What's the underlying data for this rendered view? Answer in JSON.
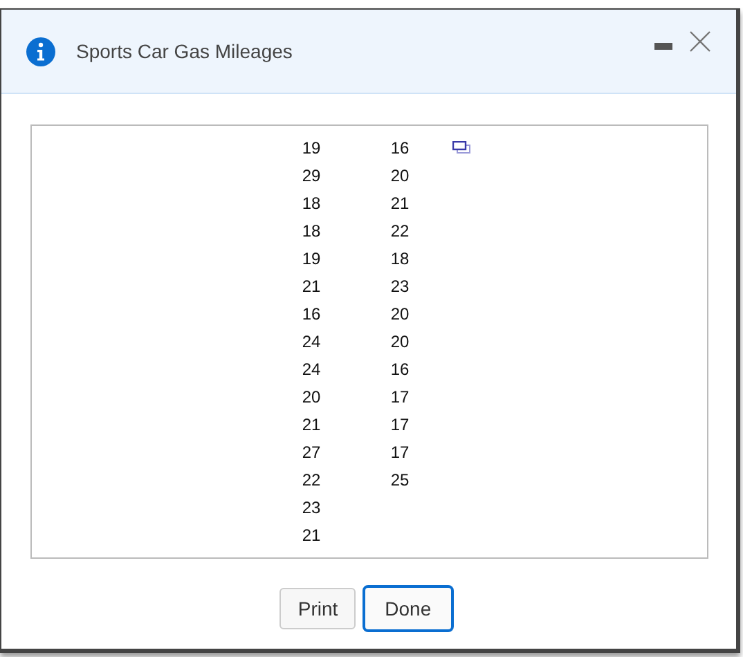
{
  "dialog": {
    "title": "Sports Car Gas Mileages"
  },
  "table": {
    "columns": [
      {
        "values": [
          "19",
          "29",
          "18",
          "18",
          "19",
          "21",
          "16",
          "24",
          "24",
          "20",
          "21",
          "27",
          "22",
          "23",
          "21"
        ]
      },
      {
        "values": [
          "16",
          "20",
          "21",
          "22",
          "18",
          "23",
          "20",
          "20",
          "16",
          "17",
          "17",
          "17",
          "25"
        ]
      }
    ]
  },
  "buttons": [
    {
      "label": "Print",
      "selected": false
    },
    {
      "label": "Done",
      "selected": true
    }
  ]
}
